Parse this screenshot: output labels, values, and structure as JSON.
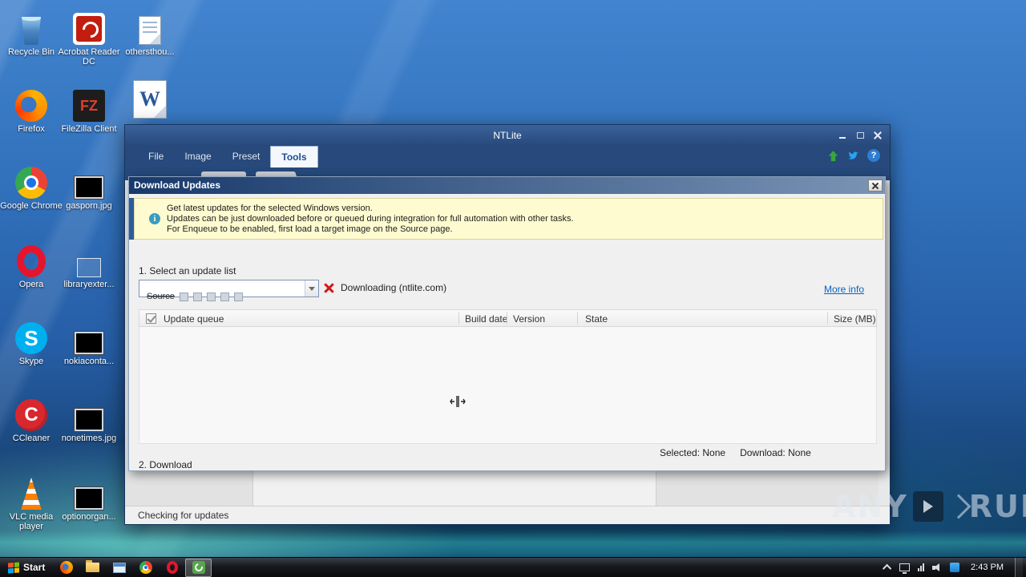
{
  "desktop": {
    "col1": [
      {
        "icon": "recycle-bin",
        "label": "Recycle Bin"
      },
      {
        "icon": "firefox",
        "label": "Firefox"
      },
      {
        "icon": "chrome",
        "label": "Google Chrome"
      },
      {
        "icon": "opera",
        "label": "Opera"
      },
      {
        "icon": "skype",
        "label": "Skype"
      },
      {
        "icon": "ccleaner",
        "label": "CCleaner"
      },
      {
        "icon": "vlc",
        "label": "VLC media player"
      }
    ],
    "col2": [
      {
        "icon": "acrobat",
        "label": "Acrobat Reader DC"
      },
      {
        "icon": "filezilla",
        "label": "FileZilla Client"
      },
      {
        "icon": "image-file",
        "label": "gasporn.jpg"
      },
      {
        "icon": "image-file-light",
        "label": "libraryexter..."
      },
      {
        "icon": "image-file",
        "label": "nokiaconta..."
      },
      {
        "icon": "image-file",
        "label": "nonetimes.jpg"
      },
      {
        "icon": "image-file",
        "label": "optionorgan..."
      }
    ],
    "col3": [
      {
        "icon": "page-file",
        "label": "othersthou..."
      },
      {
        "icon": "word-doc",
        "label": ""
      }
    ]
  },
  "app": {
    "title": "NTLite",
    "tabs": [
      "File",
      "Image",
      "Preset",
      "Tools"
    ],
    "active_tab": "Tools",
    "status": "Checking for updates"
  },
  "icons": {
    "info_glyph": "i",
    "help_glyph": "?"
  },
  "dialog": {
    "title": "Download Updates",
    "info_lines": [
      "Get latest updates for the selected Windows version.",
      "Updates can be just downloaded before or queued during integration for full automation with other tasks.",
      "For Enqueue to be enabled, first load a target image on the Source page."
    ],
    "step1": "1. Select an update list",
    "combo_value": "",
    "ribbon_remnant": "Source",
    "download_status": "Downloading (ntlite.com)",
    "more_info": "More info",
    "table_columns": [
      "Update queue",
      "Build date",
      "Version",
      "State",
      "Size (MB)"
    ],
    "selected": "Selected: None",
    "download": "Download: None",
    "step2": "2. Download"
  },
  "taskbar": {
    "start": "Start",
    "clock": "2:43 PM"
  },
  "watermark": {
    "left": "ANY",
    "right": "RUN"
  }
}
